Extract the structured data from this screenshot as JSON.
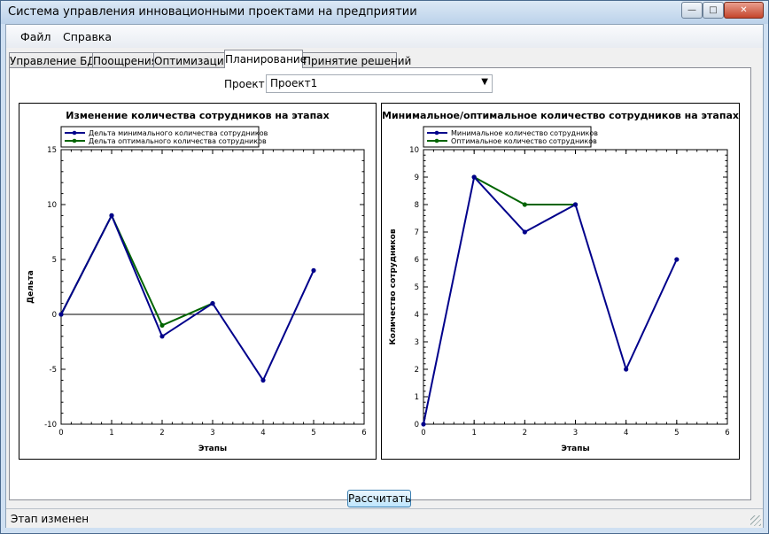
{
  "window": {
    "title": "Система управления инновационными проектами на предприятии",
    "min_icon": "minimize-icon",
    "max_icon": "maximize-icon",
    "close_icon": "close-icon"
  },
  "menu": [
    {
      "label": "Файл"
    },
    {
      "label": "Справка"
    }
  ],
  "tabs": [
    {
      "label": "Управление БД",
      "active": false
    },
    {
      "label": "Поощрения",
      "active": false
    },
    {
      "label": "Оптимизация",
      "active": false
    },
    {
      "label": "Планирование",
      "active": true
    },
    {
      "label": "Принятие решений",
      "active": false
    }
  ],
  "project": {
    "label": "Проект",
    "value": "Проект1"
  },
  "calculate_label": "Рассчитать",
  "status": "Этап изменен",
  "chart_data": [
    {
      "type": "line",
      "title": "Изменение количества сотрудников на этапах",
      "xlabel": "Этапы",
      "ylabel": "Дельта",
      "xlim": [
        0,
        6
      ],
      "ylim": [
        -10,
        15
      ],
      "xticks": [
        0,
        1,
        2,
        3,
        4,
        5,
        6
      ],
      "yticks": [
        -10,
        -5,
        0,
        5,
        10,
        15
      ],
      "zero_line": true,
      "legend_position": "top-left",
      "series": [
        {
          "name": "Дельта минимального количества сотрудников",
          "color": "#00008b",
          "x": [
            0,
            1,
            2,
            3,
            4,
            5
          ],
          "y": [
            0,
            9,
            -2,
            1,
            -6,
            4
          ]
        },
        {
          "name": "Дельта оптимального количества сотрудников",
          "color": "#006400",
          "x": [
            0,
            1,
            2,
            3
          ],
          "y": [
            0,
            9,
            -1,
            1
          ]
        }
      ]
    },
    {
      "type": "line",
      "title": "Минимальное/оптимальное количество сотрудников на этапах",
      "xlabel": "Этапы",
      "ylabel": "Количество сотрудников",
      "xlim": [
        0,
        6
      ],
      "ylim": [
        0,
        10
      ],
      "xticks": [
        0,
        1,
        2,
        3,
        4,
        5,
        6
      ],
      "yticks": [
        0,
        1,
        2,
        3,
        4,
        5,
        6,
        7,
        8,
        9,
        10
      ],
      "zero_line": false,
      "legend_position": "top-left",
      "series": [
        {
          "name": "Минимальное количество сотрудников",
          "color": "#00008b",
          "x": [
            0,
            1,
            2,
            3,
            4,
            5
          ],
          "y": [
            0,
            9,
            7,
            8,
            2,
            6
          ]
        },
        {
          "name": "Оптимальное количество сотрудников",
          "color": "#006400",
          "x": [
            1,
            2,
            3
          ],
          "y": [
            9,
            8,
            8
          ]
        }
      ]
    }
  ]
}
